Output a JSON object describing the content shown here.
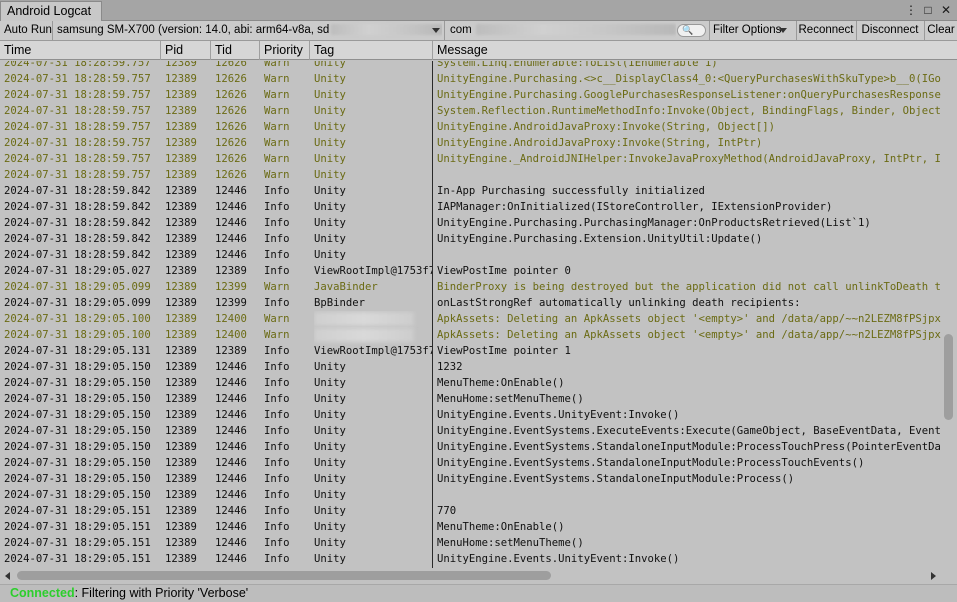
{
  "window": {
    "tab_title": "Android Logcat",
    "menu_glyph": "⋮",
    "maximize_glyph": "□",
    "close_glyph": "✕"
  },
  "toolbar": {
    "auto_run": "Auto Run",
    "device_label": "samsung SM-X700 (version: 14.0, abi: arm64-v8a, sd",
    "filter_value": "com",
    "search_glyph": "🔍",
    "filter_options": "Filter Options",
    "reconnect": "Reconnect",
    "disconnect": "Disconnect",
    "clear": "Clear"
  },
  "columns": {
    "time": "Time",
    "pid": "Pid",
    "tid": "Tid",
    "priority": "Priority",
    "tag": "Tag",
    "message": "Message"
  },
  "log_rows": [
    {
      "time": "2024-07-31 18:28:59.757",
      "pid": "12389",
      "tid": "12626",
      "priority": "Warn",
      "tag": "Unity",
      "message": "System.Linq.Enumerable:ToList(IEnumerable`1)"
    },
    {
      "time": "2024-07-31 18:28:59.757",
      "pid": "12389",
      "tid": "12626",
      "priority": "Warn",
      "tag": "Unity",
      "message": "UnityEngine.Purchasing.<>c__DisplayClass4_0:<QueryPurchasesWithSkuType>b__0(IGoogleB"
    },
    {
      "time": "2024-07-31 18:28:59.757",
      "pid": "12389",
      "tid": "12626",
      "priority": "Warn",
      "tag": "Unity",
      "message": "UnityEngine.Purchasing.GooglePurchasesResponseListener:onQueryPurchasesResponse(Andr"
    },
    {
      "time": "2024-07-31 18:28:59.757",
      "pid": "12389",
      "tid": "12626",
      "priority": "Warn",
      "tag": "Unity",
      "message": "System.Reflection.RuntimeMethodInfo:Invoke(Object, BindingFlags, Binder, Object[], C"
    },
    {
      "time": "2024-07-31 18:28:59.757",
      "pid": "12389",
      "tid": "12626",
      "priority": "Warn",
      "tag": "Unity",
      "message": "UnityEngine.AndroidJavaProxy:Invoke(String, Object[])"
    },
    {
      "time": "2024-07-31 18:28:59.757",
      "pid": "12389",
      "tid": "12626",
      "priority": "Warn",
      "tag": "Unity",
      "message": "UnityEngine.AndroidJavaProxy:Invoke(String, IntPtr)"
    },
    {
      "time": "2024-07-31 18:28:59.757",
      "pid": "12389",
      "tid": "12626",
      "priority": "Warn",
      "tag": "Unity",
      "message": "UnityEngine._AndroidJNIHelper:InvokeJavaProxyMethod(AndroidJavaProxy, IntPtr, IntPtr"
    },
    {
      "time": "2024-07-31 18:28:59.757",
      "pid": "12389",
      "tid": "12626",
      "priority": "Warn",
      "tag": "Unity",
      "message": ""
    },
    {
      "time": "2024-07-31 18:28:59.842",
      "pid": "12389",
      "tid": "12446",
      "priority": "Info",
      "tag": "Unity",
      "message": "In-App Purchasing successfully initialized"
    },
    {
      "time": "2024-07-31 18:28:59.842",
      "pid": "12389",
      "tid": "12446",
      "priority": "Info",
      "tag": "Unity",
      "message": "IAPManager:OnInitialized(IStoreController, IExtensionProvider)"
    },
    {
      "time": "2024-07-31 18:28:59.842",
      "pid": "12389",
      "tid": "12446",
      "priority": "Info",
      "tag": "Unity",
      "message": "UnityEngine.Purchasing.PurchasingManager:OnProductsRetrieved(List`1)"
    },
    {
      "time": "2024-07-31 18:28:59.842",
      "pid": "12389",
      "tid": "12446",
      "priority": "Info",
      "tag": "Unity",
      "message": "UnityEngine.Purchasing.Extension.UnityUtil:Update()"
    },
    {
      "time": "2024-07-31 18:28:59.842",
      "pid": "12389",
      "tid": "12446",
      "priority": "Info",
      "tag": "Unity",
      "message": ""
    },
    {
      "time": "2024-07-31 18:29:05.027",
      "pid": "12389",
      "tid": "12389",
      "priority": "Info",
      "tag": "ViewRootImpl@1753f7c",
      "message": "ViewPostIme pointer 0"
    },
    {
      "time": "2024-07-31 18:29:05.099",
      "pid": "12389",
      "tid": "12399",
      "priority": "Warn",
      "tag": "JavaBinder",
      "message": "BinderProxy is being destroyed but the application did not call unlinkToDeath to unl"
    },
    {
      "time": "2024-07-31 18:29:05.099",
      "pid": "12389",
      "tid": "12399",
      "priority": "Info",
      "tag": "BpBinder",
      "message": "onLastStrongRef automatically unlinking death recipients:"
    },
    {
      "time": "2024-07-31 18:29:05.100",
      "pid": "12389",
      "tid": "12400",
      "priority": "Warn",
      "tag": "",
      "message": "ApkAssets: Deleting an ApkAssets object '<empty>' and /data/app/~~n2LEZM8fPSjpxCi7G79"
    },
    {
      "time": "2024-07-31 18:29:05.100",
      "pid": "12389",
      "tid": "12400",
      "priority": "Warn",
      "tag": "",
      "message": "ApkAssets: Deleting an ApkAssets object '<empty>' and /data/app/~~n2LEZM8fPSjpxCi7G79"
    },
    {
      "time": "2024-07-31 18:29:05.131",
      "pid": "12389",
      "tid": "12389",
      "priority": "Info",
      "tag": "ViewRootImpl@1753f7c",
      "message": "ViewPostIme pointer 1"
    },
    {
      "time": "2024-07-31 18:29:05.150",
      "pid": "12389",
      "tid": "12446",
      "priority": "Info",
      "tag": "Unity",
      "message": "1232"
    },
    {
      "time": "2024-07-31 18:29:05.150",
      "pid": "12389",
      "tid": "12446",
      "priority": "Info",
      "tag": "Unity",
      "message": "MenuTheme:OnEnable()"
    },
    {
      "time": "2024-07-31 18:29:05.150",
      "pid": "12389",
      "tid": "12446",
      "priority": "Info",
      "tag": "Unity",
      "message": "MenuHome:setMenuTheme()"
    },
    {
      "time": "2024-07-31 18:29:05.150",
      "pid": "12389",
      "tid": "12446",
      "priority": "Info",
      "tag": "Unity",
      "message": "UnityEngine.Events.UnityEvent:Invoke()"
    },
    {
      "time": "2024-07-31 18:29:05.150",
      "pid": "12389",
      "tid": "12446",
      "priority": "Info",
      "tag": "Unity",
      "message": "UnityEngine.EventSystems.ExecuteEvents:Execute(GameObject, BaseEventData, EventFunct"
    },
    {
      "time": "2024-07-31 18:29:05.150",
      "pid": "12389",
      "tid": "12446",
      "priority": "Info",
      "tag": "Unity",
      "message": "UnityEngine.EventSystems.StandaloneInputModule:ProcessTouchPress(PointerEventData, B"
    },
    {
      "time": "2024-07-31 18:29:05.150",
      "pid": "12389",
      "tid": "12446",
      "priority": "Info",
      "tag": "Unity",
      "message": "UnityEngine.EventSystems.StandaloneInputModule:ProcessTouchEvents()"
    },
    {
      "time": "2024-07-31 18:29:05.150",
      "pid": "12389",
      "tid": "12446",
      "priority": "Info",
      "tag": "Unity",
      "message": "UnityEngine.EventSystems.StandaloneInputModule:Process()"
    },
    {
      "time": "2024-07-31 18:29:05.150",
      "pid": "12389",
      "tid": "12446",
      "priority": "Info",
      "tag": "Unity",
      "message": ""
    },
    {
      "time": "2024-07-31 18:29:05.151",
      "pid": "12389",
      "tid": "12446",
      "priority": "Info",
      "tag": "Unity",
      "message": "770"
    },
    {
      "time": "2024-07-31 18:29:05.151",
      "pid": "12389",
      "tid": "12446",
      "priority": "Info",
      "tag": "Unity",
      "message": "MenuTheme:OnEnable()"
    },
    {
      "time": "2024-07-31 18:29:05.151",
      "pid": "12389",
      "tid": "12446",
      "priority": "Info",
      "tag": "Unity",
      "message": "MenuHome:setMenuTheme()"
    },
    {
      "time": "2024-07-31 18:29:05.151",
      "pid": "12389",
      "tid": "12446",
      "priority": "Info",
      "tag": "Unity",
      "message": "UnityEngine.Events.UnityEvent:Invoke()"
    }
  ],
  "colors": {
    "warn": "#6b6b14",
    "info": "#101010",
    "connected": "#2ccf2c"
  },
  "status": {
    "connected": "Connected",
    "message": ": Filtering with Priority 'Verbose'"
  }
}
